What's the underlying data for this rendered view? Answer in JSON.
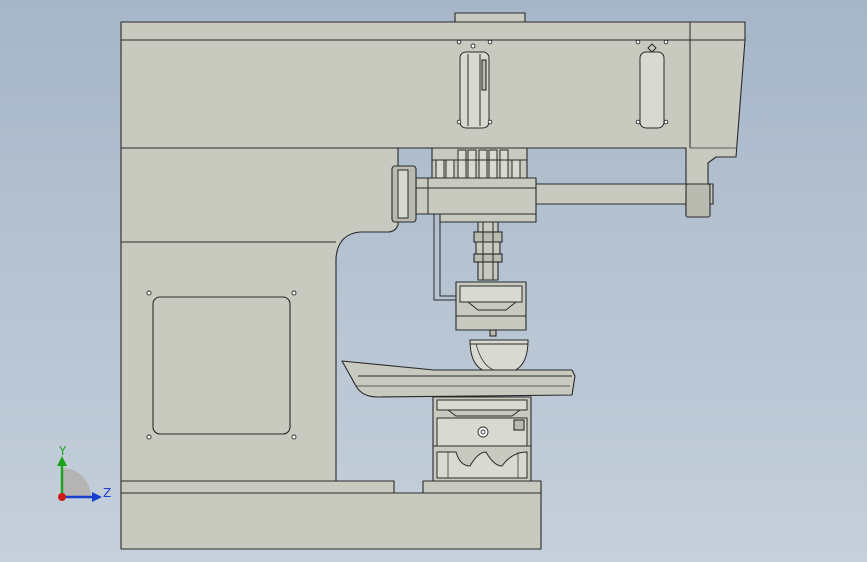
{
  "view": {
    "background_top": "#a6b6c8",
    "background_bottom": "#c6d0dc",
    "part_color": "#c8c9bf"
  },
  "triad": {
    "y_label": "Y",
    "z_label": "Z",
    "y_color": "#1aa31a",
    "z_color": "#1a3fcc",
    "x_color": "#d01a1a"
  }
}
